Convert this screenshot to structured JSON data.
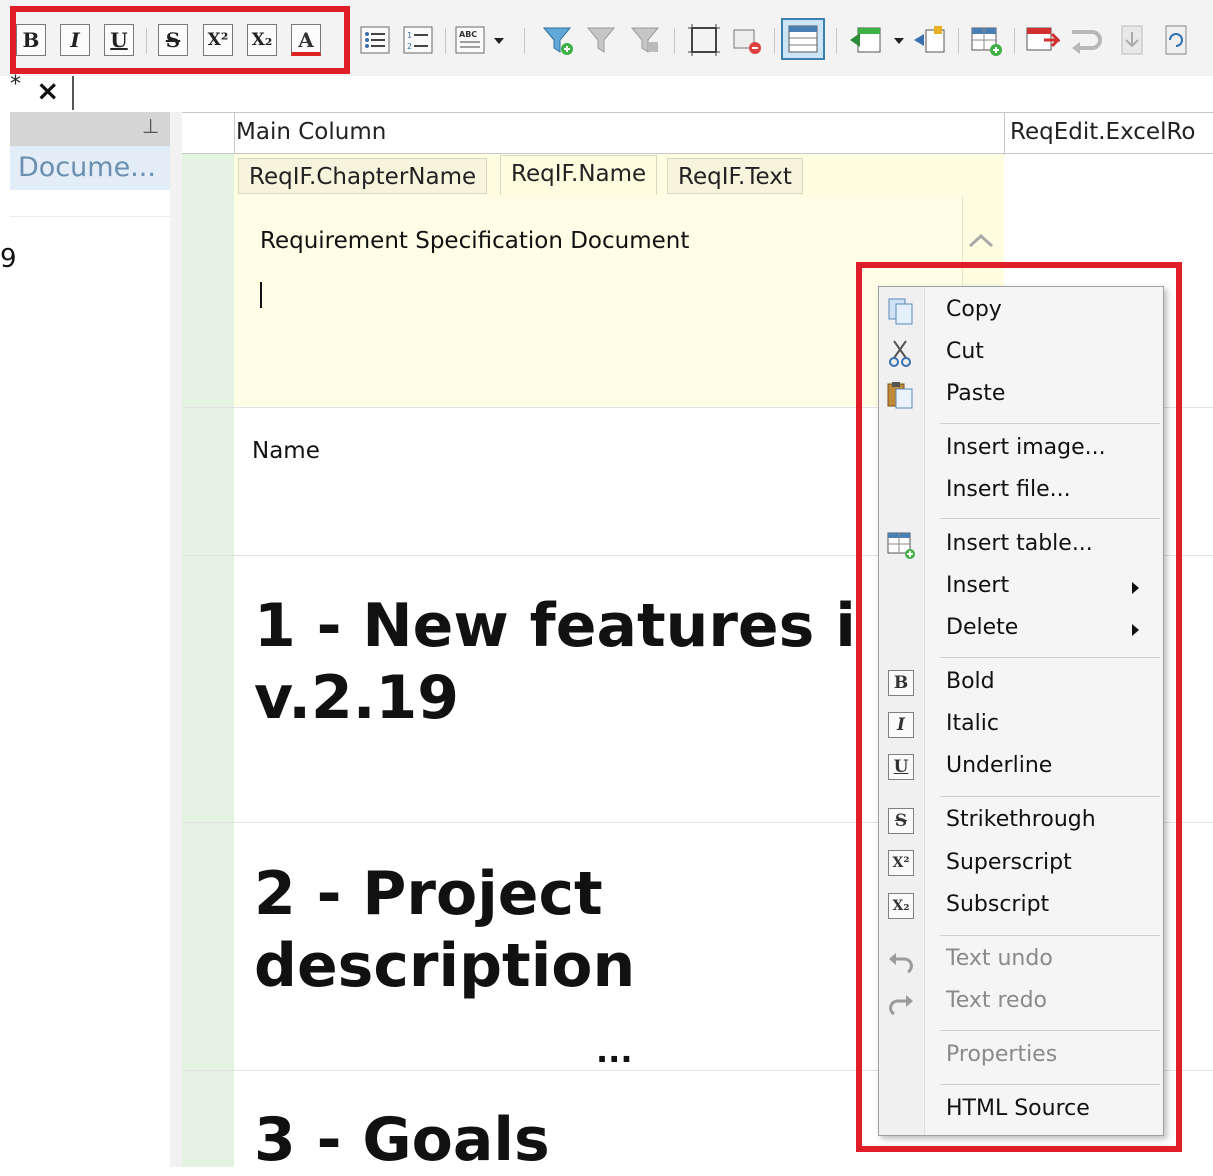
{
  "toolbar": {
    "format_buttons": [
      {
        "name": "bold",
        "glyph": "B"
      },
      {
        "name": "italic",
        "glyph": "I"
      },
      {
        "name": "underline",
        "glyph": "U"
      },
      {
        "name": "strikethrough",
        "glyph": "S"
      },
      {
        "name": "superscript",
        "glyph": "X²"
      },
      {
        "name": "subscript",
        "glyph": "X₂"
      },
      {
        "name": "font-color",
        "glyph": "A"
      }
    ]
  },
  "tabstrip": {
    "modified_marker": "*",
    "close_glyph": "×"
  },
  "left_panel": {
    "pin_glyph": "⊥",
    "item_label": "Docume...",
    "partial_char": "9"
  },
  "grid": {
    "col_main": "Main Column",
    "col_reqedit": "ReqEdit.ExcelRo",
    "subtabs": [
      "ReqIF.ChapterName",
      "ReqIF.Name",
      "ReqIF.Text"
    ],
    "editor_text": "Requirement Specification Document",
    "name_label": "Name",
    "heading1_line1": "1 - New features i",
    "heading1_line2": "v.2.19",
    "heading2_line1": "2 - Project",
    "heading2_line2": "description",
    "ellipsis": "...",
    "heading3": "3 - Goals"
  },
  "menu": {
    "copy": "Copy",
    "cut": "Cut",
    "paste": "Paste",
    "insert_image": "Insert image...",
    "insert_file": "Insert file...",
    "insert_table": "Insert table...",
    "insert": "Insert",
    "delete": "Delete",
    "bold": "Bold",
    "italic": "Italic",
    "underline": "Underline",
    "strikethrough": "Strikethrough",
    "superscript": "Superscript",
    "subscript": "Subscript",
    "text_undo": "Text undo",
    "text_redo": "Text redo",
    "properties": "Properties",
    "html_source": "HTML Source"
  },
  "colors": {
    "highlight": "#e01e2a",
    "row_indicator": "#e4f3e2",
    "editor_bg": "#fffde0"
  }
}
